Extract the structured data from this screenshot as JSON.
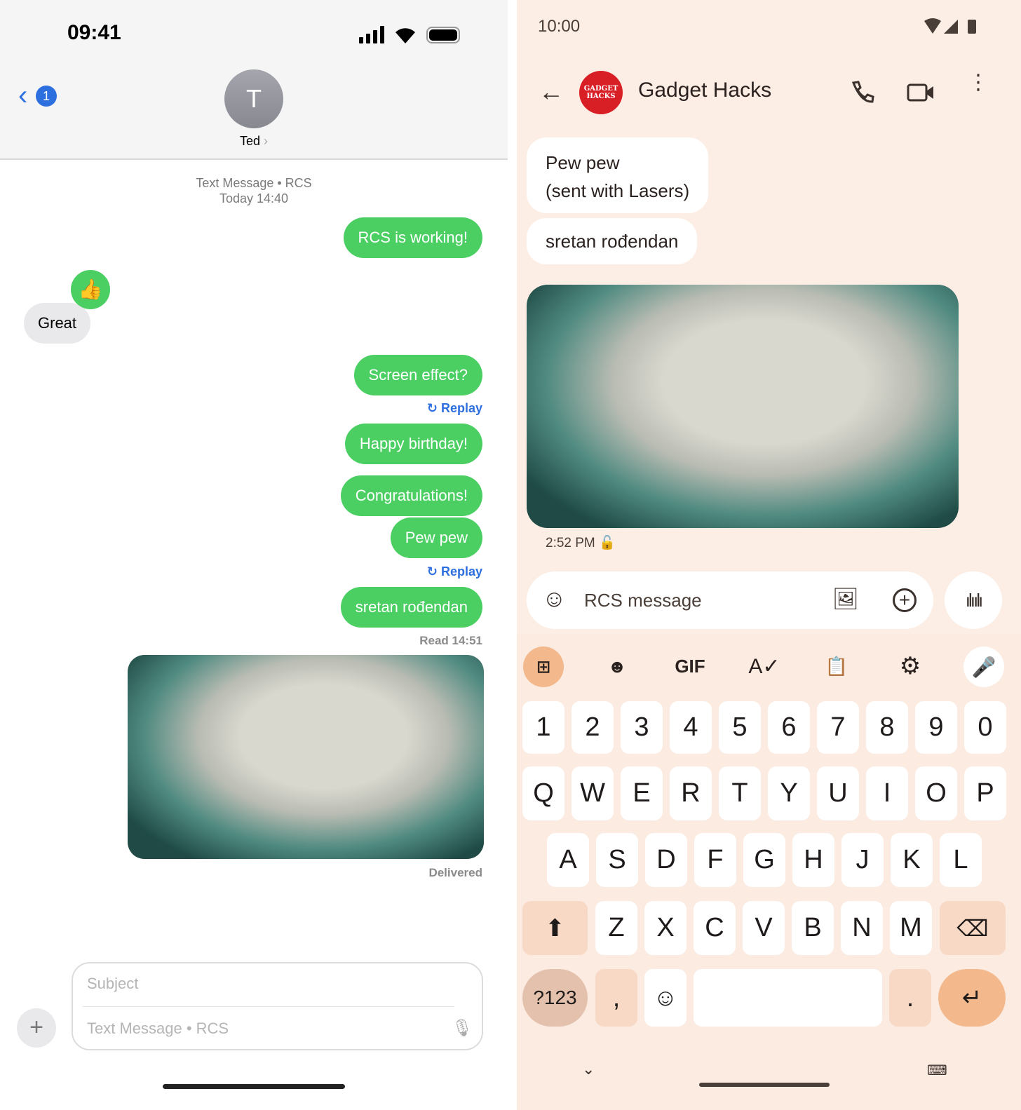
{
  "ios": {
    "status_time": "09:41",
    "back_badge": "1",
    "contact_initial": "T",
    "contact_name": "Ted",
    "meta_line1": "Text Message • RCS",
    "meta_line2": "Today 14:40",
    "messages": [
      {
        "text": "RCS is working!",
        "dir": "out"
      },
      {
        "text": "Great",
        "dir": "in",
        "reaction": "thumbs-up"
      },
      {
        "text": "Screen effect?",
        "dir": "out",
        "replay": "Replay"
      },
      {
        "text": "Happy birthday!",
        "dir": "out"
      },
      {
        "text": "Congratulations!",
        "dir": "out"
      },
      {
        "text": "Pew pew",
        "dir": "out",
        "replay": "Replay"
      },
      {
        "text": "sretan rođendan",
        "dir": "out",
        "status": "Read 14:51"
      }
    ],
    "image_status": "Delivered",
    "subject_placeholder": "Subject",
    "message_placeholder": "Text Message • RCS",
    "accent": "#4bcf63"
  },
  "android": {
    "status_time": "10:00",
    "logo_text": "GADGET HACKS",
    "contact_name": "Gadget Hacks",
    "messages": [
      {
        "line1": "Pew pew",
        "line2": "(sent with Lasers)"
      },
      {
        "line1": "sretan rođendan"
      }
    ],
    "image_time": "2:52 PM",
    "input_placeholder": "RCS message",
    "toolbar_gif": "GIF",
    "keyboard": {
      "row1": [
        "1",
        "2",
        "3",
        "4",
        "5",
        "6",
        "7",
        "8",
        "9",
        "0"
      ],
      "row2": [
        "Q",
        "W",
        "E",
        "R",
        "T",
        "Y",
        "U",
        "I",
        "O",
        "P"
      ],
      "row3": [
        "A",
        "S",
        "D",
        "F",
        "G",
        "H",
        "J",
        "K",
        "L"
      ],
      "row4": [
        "Z",
        "X",
        "C",
        "V",
        "B",
        "N",
        "M"
      ],
      "symbols": "?123",
      "comma": ",",
      "period": "."
    },
    "bg": "#fdeee5",
    "accent": "#f3b98d"
  }
}
